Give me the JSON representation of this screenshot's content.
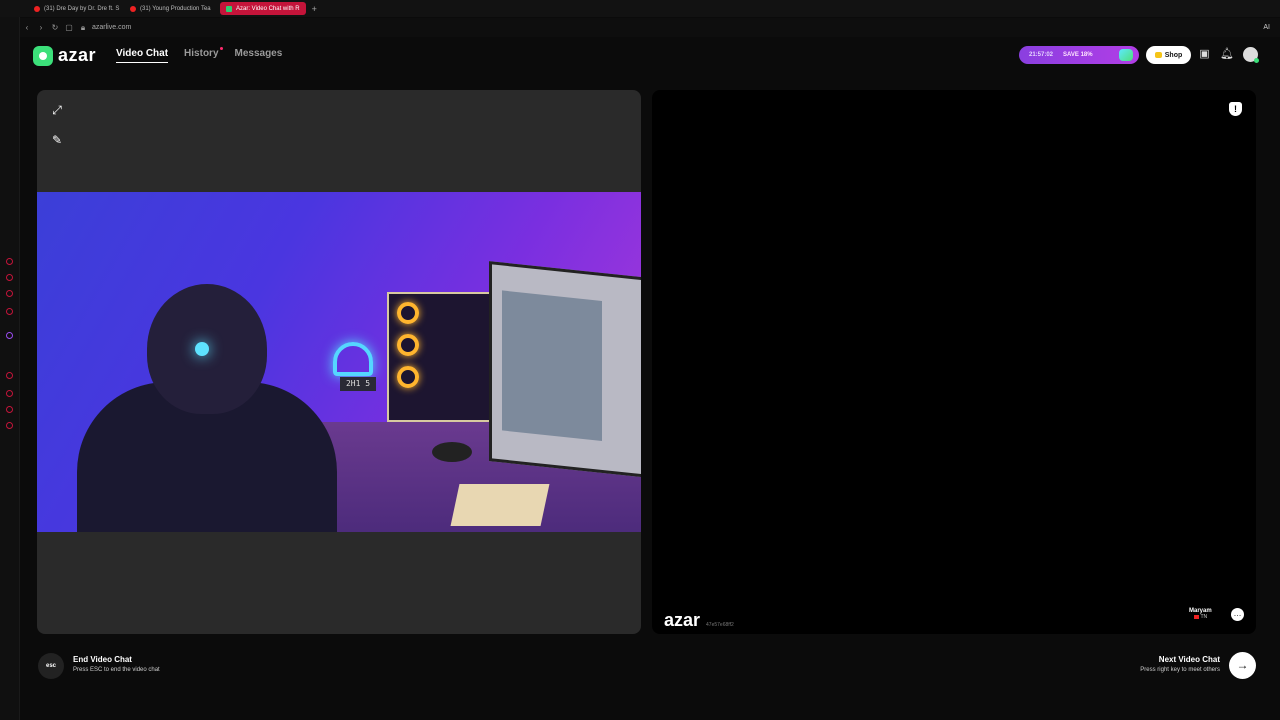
{
  "browser": {
    "tabs": [
      {
        "label": "(31) Dre Day by Dr. Dre ft. S"
      },
      {
        "label": "(31) Young Production Tea"
      },
      {
        "label": "Azar: Video Chat with R"
      }
    ],
    "new_tab_symbol": "+",
    "url": "azarlive.com",
    "ai_label": "AI"
  },
  "app": {
    "logo_text": "azar",
    "nav": {
      "video_chat": "Video Chat",
      "history": "History",
      "messages": "Messages"
    },
    "promo": {
      "timer": "21:57:02",
      "save": "SAVE 18%"
    },
    "shop_label": "Shop"
  },
  "video": {
    "self": {
      "clock": "2H1 5"
    },
    "remote": {
      "watermark": "azar",
      "watermark_id": "47e57e68ff2",
      "peer_name": "Maryam",
      "peer_country": "TN"
    }
  },
  "footer": {
    "esc_label": "esc",
    "end_title": "End Video Chat",
    "end_subtitle": "Press ESC to end the video chat",
    "next_title": "Next Video Chat",
    "next_subtitle": "Press right key to meet others"
  },
  "colors": {
    "accent_green": "#3ce07a",
    "tab_active": "#c4143a",
    "promo_purple": "#8a3fe0"
  }
}
